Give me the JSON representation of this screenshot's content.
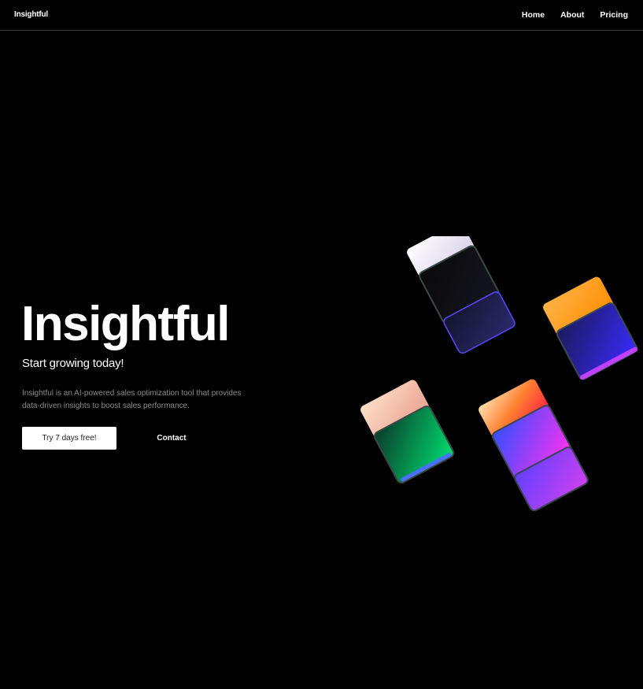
{
  "nav": {
    "brand": "Insightful",
    "links": [
      {
        "label": "Home"
      },
      {
        "label": "About"
      },
      {
        "label": "Pricing"
      }
    ]
  },
  "hero": {
    "title": "Insightful",
    "subtitle": "Start growing today!",
    "description": "Insightful is an AI-powered sales optimization tool that provides data-driven insights to boost sales performance.",
    "primary_cta": "Try 7 days free!",
    "secondary_cta": "Contact"
  },
  "colors": {
    "background": "#000000",
    "text": "#ffffff",
    "muted_text": "#8a8a8a",
    "divider": "#3a3a3a"
  }
}
